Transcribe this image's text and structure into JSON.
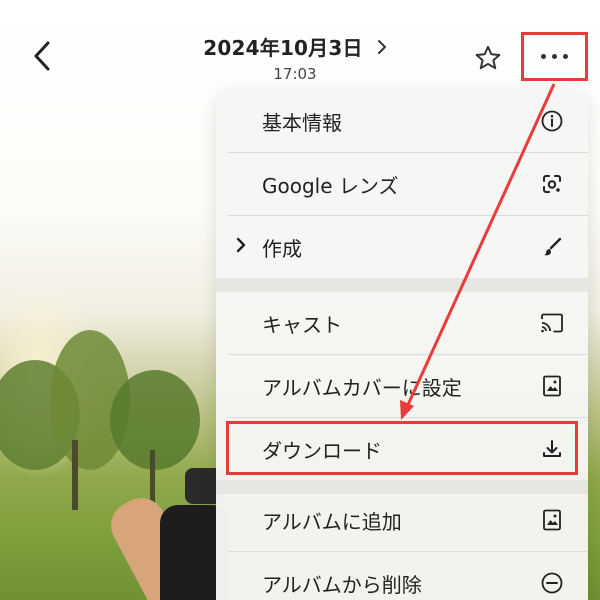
{
  "header": {
    "date": "2024年10月3日",
    "time": "17:03"
  },
  "menu": {
    "items": [
      {
        "label": "基本情報",
        "icon": "info-icon"
      },
      {
        "label": "Google レンズ",
        "icon": "lens-icon"
      },
      {
        "label": "作成",
        "icon": "brush-icon",
        "has_submenu": true
      },
      {
        "label": "キャスト",
        "icon": "cast-icon"
      },
      {
        "label": "アルバムカバーに設定",
        "icon": "album-icon"
      },
      {
        "label": "ダウンロード",
        "icon": "download-icon",
        "highlighted": true
      },
      {
        "label": "アルバムに追加",
        "icon": "album-add-icon"
      },
      {
        "label": "アルバムから削除",
        "icon": "remove-circle-icon"
      }
    ]
  },
  "annotation": {
    "highlight_color": "#ea3b3b"
  }
}
